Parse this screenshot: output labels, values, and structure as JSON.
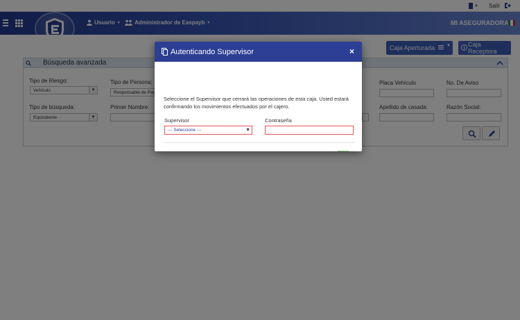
{
  "topbar": {
    "logout_label": "Salir"
  },
  "navbar": {
    "user_menu": "Usuario",
    "admin_menu": "Administrador de Easpayb",
    "brand": "MI ASEGURADORA"
  },
  "toolbar": {
    "caja_aperturada": "Caja Aperturada",
    "caja_receptora": "Caja Receptora"
  },
  "search_panel": {
    "title": "Búsqueda avanzada",
    "fields": {
      "tipo_riesgo_label": "Tipo de Riesgo:",
      "tipo_riesgo_value": "Vehículo",
      "tipo_persona_label": "Tipo de Persona:",
      "tipo_persona_value": "Responsable de Pag",
      "placa_label": "Placa Vehículo",
      "aviso_label": "No. De Aviso",
      "tipo_busqueda_label": "Tipo de búsqueda:",
      "tipo_busqueda_value": "Equivalente",
      "primer_nombre_label": "Primer Nombre:",
      "apellido_casada_label": "Apellido de casada:",
      "razon_social_label": "Razón Social:"
    }
  },
  "modal": {
    "title": "Autenticando Supervisor",
    "close_glyph": "×",
    "message": "Seleccione el Supervisor que cerrará las operaciones de esta caja. Usted estará confirmando los movimientos efectuados por el cajero.",
    "supervisor_label": "Supervisor",
    "supervisor_placeholder": "--- Seleccione ---",
    "password_label": "Contraseña",
    "password_value": ""
  },
  "colors": {
    "navbar_dark": "#243a8f",
    "modal_header": "#2d3f94",
    "button_primary": "#3c5fb8",
    "confirm_button": "#8fd08f",
    "error_border": "#e05555"
  },
  "icons": [
    "hamburger-icon",
    "apps-icon",
    "user-icon",
    "users-icon",
    "logout-icon",
    "mx-flag-icon",
    "info-icon",
    "search-icon",
    "edit-icon",
    "copy-icon",
    "close-icon",
    "lock-icon",
    "chevron-up-icon"
  ]
}
